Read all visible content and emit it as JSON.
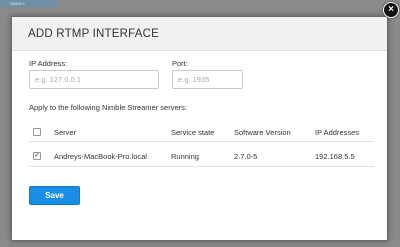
{
  "backdrop": {
    "tab_label": "NIMBLE"
  },
  "dialog": {
    "title": "ADD RTMP INTERFACE",
    "close_symbol": "×"
  },
  "form": {
    "ip_address": {
      "label": "IP Address:",
      "value": "",
      "placeholder": "e.g. 127.0.0.1"
    },
    "port": {
      "label": "Port:",
      "value": "",
      "placeholder": "e.g. 1935"
    },
    "apply_label": "Apply to the following Nimble Streamer servers:"
  },
  "table": {
    "headers": {
      "server": "Server",
      "service_state": "Service state",
      "software_version": "Software Version",
      "ip_addresses": "IP Addresses"
    },
    "header_checkbox_checked": false,
    "rows": [
      {
        "checked": true,
        "check_mark": "✓",
        "server": "Andreys-MacBook-Pro.local",
        "service_state": "Running",
        "software_version": "2.7.0-5",
        "ip_addresses": "192.168.5.5"
      }
    ]
  },
  "actions": {
    "save_label": "Save"
  },
  "colors": {
    "accent": "#1a8ee6",
    "header_bg": "#f1f1f1",
    "backdrop": "#8a8a8a"
  }
}
